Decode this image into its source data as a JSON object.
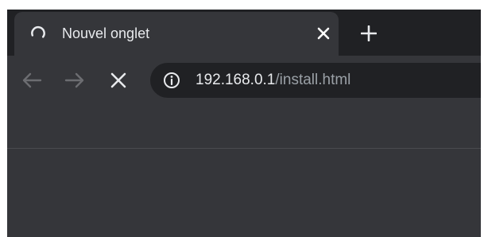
{
  "tab": {
    "title": "Nouvel onglet",
    "loading_icon": "loading-spinner-icon",
    "close_icon": "close-icon"
  },
  "new_tab_icon": "plus-icon",
  "toolbar": {
    "back_icon": "arrow-left-icon",
    "forward_icon": "arrow-right-icon",
    "stop_icon": "close-icon",
    "info_icon": "info-icon"
  },
  "address_bar": {
    "host": "192.168.0.1",
    "path": "/install.html"
  },
  "colors": {
    "frame": "#202124",
    "toolbar": "#35363a",
    "text": "#e8eaed",
    "muted_text": "#9aa0a6"
  }
}
